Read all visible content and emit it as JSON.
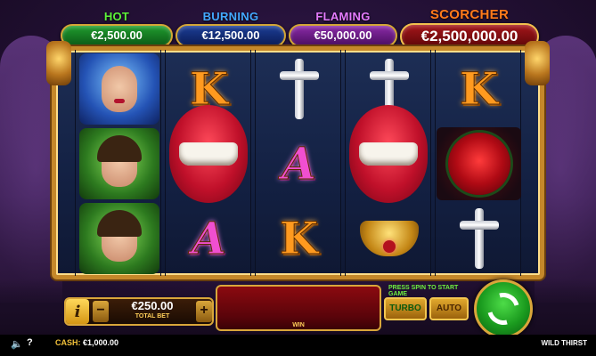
{
  "jackpots": {
    "hot": {
      "label": "HOT",
      "value": "€2,500.00"
    },
    "burning": {
      "label": "BURNING",
      "value": "€12,500.00"
    },
    "flaming": {
      "label": "FLAMING",
      "value": "€50,000.00"
    },
    "scorcher": {
      "label": "SCORCHER",
      "value": "€2,500,000.00"
    }
  },
  "reels": [
    [
      "woman-portrait",
      "man-portrait",
      "man-portrait"
    ],
    [
      "K",
      "lips",
      "A"
    ],
    [
      "cross",
      "A",
      "K"
    ],
    [
      "cross",
      "lips",
      "necklace"
    ],
    [
      "K",
      "rose",
      "cross"
    ]
  ],
  "symbols": {
    "k": "K",
    "a": "A"
  },
  "controls": {
    "info_label": "i",
    "minus_label": "−",
    "plus_label": "+",
    "bet_value": "€250.00",
    "bet_label": "TOTAL BET",
    "win_label": "WIN",
    "press_spin": "PRESS SPIN TO START GAME",
    "turbo_label": "TURBO",
    "auto_label": "AUTO"
  },
  "footer": {
    "speaker_icon": "speaker-icon",
    "help_label": "?",
    "cash_label": "CASH:",
    "cash_value": "€1,000.00",
    "game_name": "WILD THIRST"
  },
  "colors": {
    "hot": "#1f9c2e",
    "burning": "#1c3e96",
    "flaming": "#8a2aa7",
    "scorcher": "#a5161a",
    "spin": "#1a9a1e",
    "gold": "#d9a63a"
  }
}
